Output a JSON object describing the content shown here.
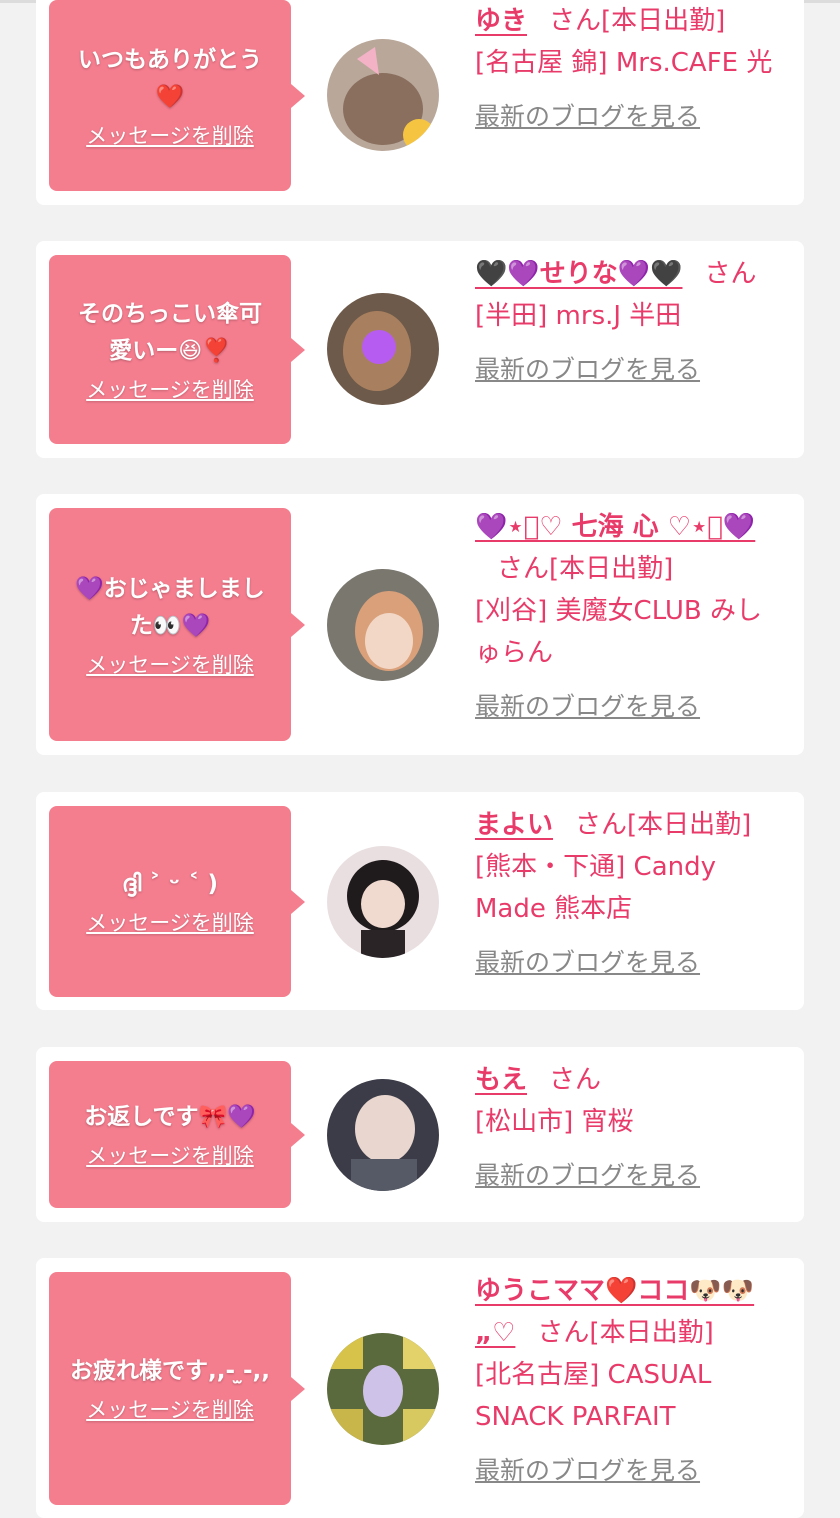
{
  "colors": {
    "accent": "#e83b6a",
    "bubble": "#f47d8e",
    "background": "#f2f2f2",
    "card": "#ffffff",
    "muted": "#888888"
  },
  "delete_label": "メッセージを削除",
  "blog_label": "最新のブログを見る",
  "san_label": "さん",
  "items": [
    {
      "message": "いつもありがとう\n❤️",
      "name": "ゆき",
      "status": "[本日出勤]",
      "shop": "[名古屋 錦] Mrs.CAFE 光"
    },
    {
      "message": "そのちっこい傘可\n愛いー😆❣️",
      "name": "🖤💜せりな💜🖤",
      "status": "",
      "shop": "[半田] mrs.J 半田"
    },
    {
      "message": "💜おじゃましまし\nた👀💜",
      "name": "💜⋆͛♡ 七海 心 ♡⋆͛💜",
      "status": "[本日出勤]",
      "shop": "[刈谷] 美魔女CLUB みしゅらん"
    },
    {
      "message": "ദ്ദി ˃ ᵕ ˂ )",
      "name": "まよい",
      "status": "[本日出勤]",
      "shop": "[熊本・下通] Candy Made 熊本店"
    },
    {
      "message": "お返しです🎀💜",
      "name": "もえ",
      "status": "",
      "shop": "[松山市] 宵桜"
    },
    {
      "message": "お疲れ様です,,- ̫-,,",
      "name": "ゆうこママ❤️ココ🐶🐶„♡",
      "status": "[本日出勤]",
      "shop": "[北名古屋] CASUAL SNACK PARFAIT"
    }
  ]
}
